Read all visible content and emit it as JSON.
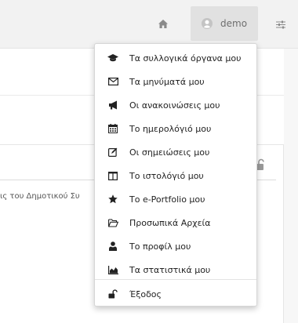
{
  "header": {
    "home_icon": "home-icon",
    "user": {
      "name": "demo",
      "icon": "user-avatar-icon"
    },
    "settings_icon": "sliders-icon"
  },
  "panel": {
    "truncated_text": "ις του Δημοτικού Συ"
  },
  "user_menu": {
    "items": [
      {
        "label": "Τα συλλογικά όργανα μου",
        "icon": "graduation-cap-icon"
      },
      {
        "label": "Τα μηνύματά μου",
        "icon": "envelope-icon"
      },
      {
        "label": "Οι ανακοινώσεις μου",
        "icon": "bullhorn-icon"
      },
      {
        "label": "Το ημερολόγιό μου",
        "icon": "calendar-icon"
      },
      {
        "label": "Οι σημειώσεις μου",
        "icon": "edit-note-icon"
      },
      {
        "label": "Το ιστολόγιό μου",
        "icon": "columns-icon"
      },
      {
        "label": "Το e-Portfolio μου",
        "icon": "star-icon"
      },
      {
        "label": "Προσωπικά Αρχεία",
        "icon": "folder-open-icon"
      },
      {
        "label": "Το προφίλ μου",
        "icon": "user-icon"
      },
      {
        "label": "Τα στατιστικά μου",
        "icon": "area-chart-icon"
      }
    ],
    "logout": {
      "label": "Έξοδος",
      "icon": "unlock-icon"
    }
  }
}
